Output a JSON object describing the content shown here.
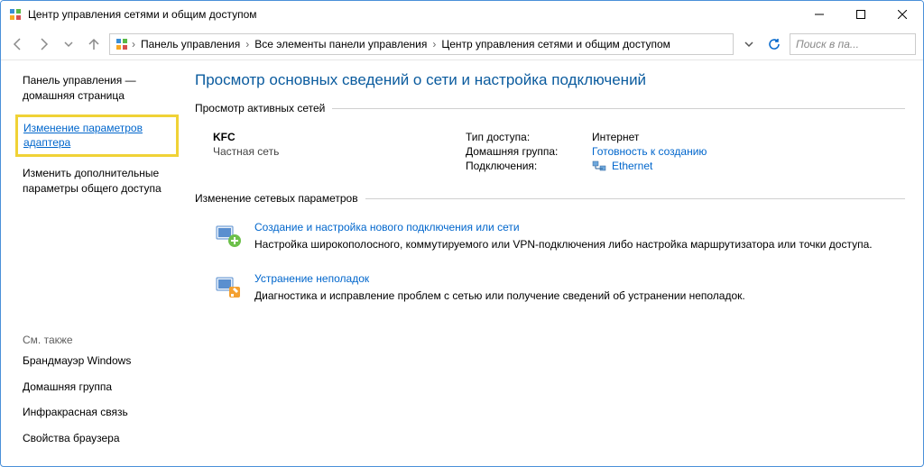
{
  "window": {
    "title": "Центр управления сетями и общим доступом"
  },
  "breadcrumb": {
    "items": [
      "Панель управления",
      "Все элементы панели управления",
      "Центр управления сетями и общим доступом"
    ]
  },
  "search": {
    "placeholder": "Поиск в па..."
  },
  "sidebar": {
    "home": "Панель управления — домашняя страница",
    "adapter": "Изменение параметров адаптера",
    "sharing": "Изменить дополнительные параметры общего доступа",
    "see_also_head": "См. также",
    "see_also": [
      "Брандмауэр Windows",
      "Домашняя группа",
      "Инфракрасная связь",
      "Свойства браузера"
    ]
  },
  "main": {
    "heading": "Просмотр основных сведений о сети и настройка подключений",
    "active_label": "Просмотр активных сетей",
    "network": {
      "name": "KFC",
      "type": "Частная сеть",
      "access_label": "Тип доступа:",
      "access_value": "Интернет",
      "homegroup_label": "Домашняя группа:",
      "homegroup_value": "Готовность к созданию",
      "conn_label": "Подключения:",
      "conn_value": "Ethernet"
    },
    "change_label": "Изменение сетевых параметров",
    "tasks": [
      {
        "title": "Создание и настройка нового подключения или сети",
        "desc": "Настройка широкополосного, коммутируемого или VPN-подключения либо настройка маршрутизатора или точки доступа."
      },
      {
        "title": "Устранение неполадок",
        "desc": "Диагностика и исправление проблем с сетью или получение сведений об устранении неполадок."
      }
    ]
  }
}
